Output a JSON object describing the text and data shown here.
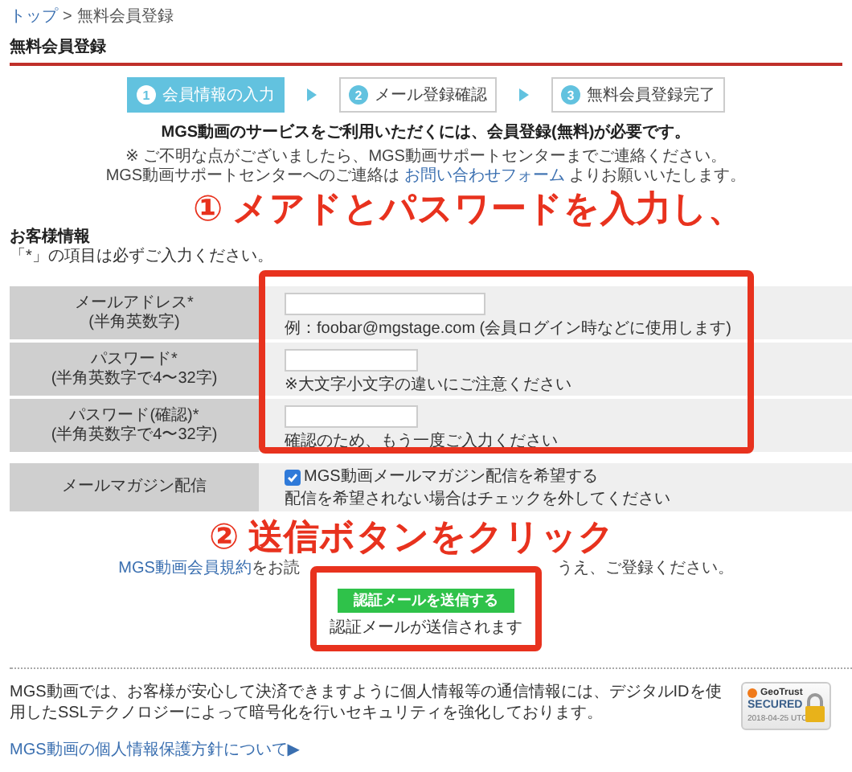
{
  "breadcrumb": {
    "items": [
      {
        "label": "トップ",
        "link": true
      },
      {
        "label": "無料会員登録",
        "link": false
      }
    ],
    "separator": ">"
  },
  "page_title": "無料会員登録",
  "steps": [
    {
      "number": "1",
      "label": "会員情報の入力",
      "selected": true
    },
    {
      "number": "2",
      "label": "メール登録確認",
      "selected": false
    },
    {
      "number": "3",
      "label": "無料会員登録完了",
      "selected": false
    }
  ],
  "intro": {
    "lead": "MGS動画のサービスをご利用いただくには、会員登録(無料)が必要です。",
    "note": "※ ご不明な点がございましたら、MGS動画サポートセンターまでご連絡ください。",
    "contact_before": "MGS動画サポートセンターへのご連絡は",
    "contact_link": "お問い合わせフォーム",
    "contact_after": "よりお願いいたします。"
  },
  "customer_info": {
    "heading": "お客様情報",
    "required_note": "「*」の項目は必ずご入力ください。"
  },
  "form_rows": [
    {
      "kind": "email",
      "label": "メールアドレス*",
      "sublabel": "(半角英数字)",
      "hint": "例：foobar@mgstage.com (会員ログイン時などに使用します)"
    },
    {
      "kind": "password",
      "label": "パスワード*",
      "sublabel": "(半角英数字で4〜32字)",
      "hint": "※大文字小文字の違いにご注意ください"
    },
    {
      "kind": "password",
      "label": "パスワード(確認)*",
      "sublabel": "(半角英数字で4〜32字)",
      "hint": "確認のため、もう一度ご入力ください"
    },
    {
      "kind": "checkbox",
      "label": "メールマガジン配信",
      "option": "MGS動画メールマガジン配信を希望する",
      "checked": true,
      "hint": "配信を希望されない場合はチェックを外してください"
    }
  ],
  "terms": {
    "link": "MGS動画会員規約",
    "before_gap": "をお読",
    "after_gap": "うえ、ご登録ください。"
  },
  "submit": {
    "button": "認証メールを送信する",
    "note": "認証メールが送信されます"
  },
  "annotations": [
    "① メアドとパスワードを入力し、",
    "② 送信ボタンをクリック"
  ],
  "footer": {
    "security_text": "MGS動画では、お客様が安心して決済できますように個人情報等の通信情報には、デジタルIDを使用したSSLテクノロジーによって暗号化を行いセキュリティを強化しております。",
    "badge": {
      "brand": "GeoTrust",
      "status": "SECURED",
      "date": "2018-04-25 UTC"
    },
    "privacy_link": "MGS動画の個人情報保護方針について▶"
  }
}
